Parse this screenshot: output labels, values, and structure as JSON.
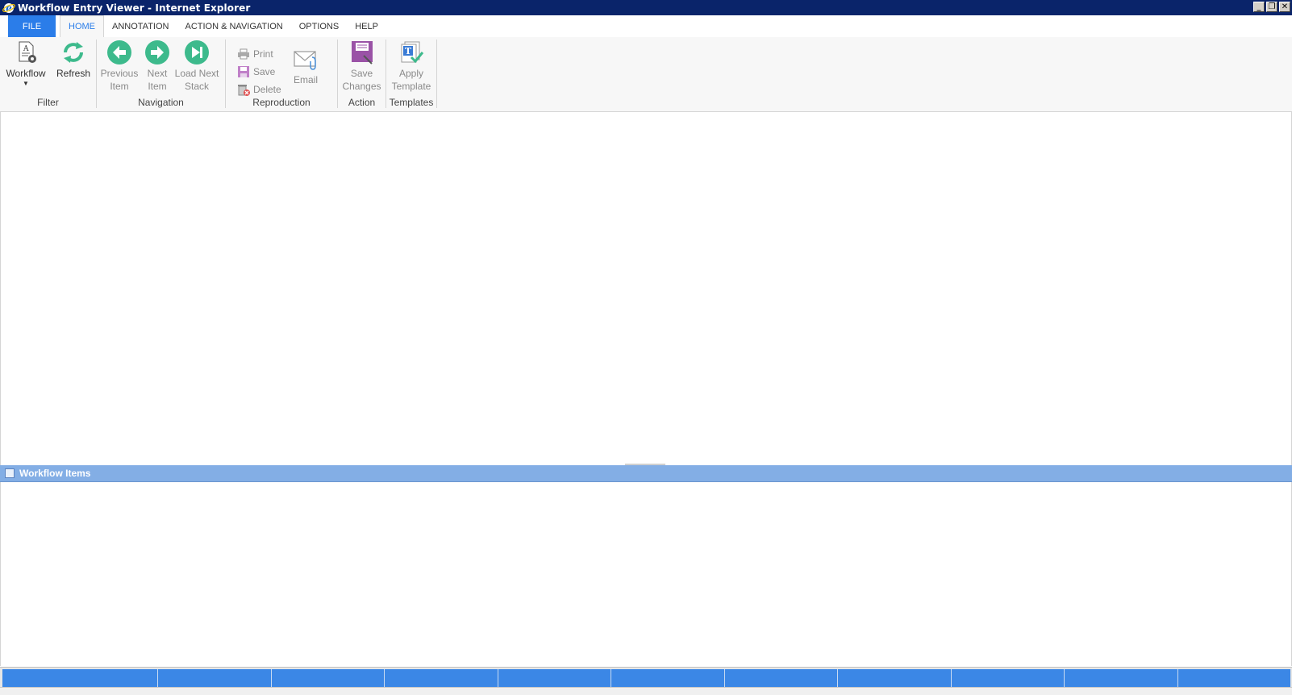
{
  "window": {
    "title": "Workflow Entry Viewer - Internet Explorer",
    "controls": [
      "minimize",
      "restore",
      "close"
    ]
  },
  "tabs": [
    {
      "label": "FILE"
    },
    {
      "label": "HOME"
    },
    {
      "label": "ANNOTATION"
    },
    {
      "label": "ACTION & NAVIGATION"
    },
    {
      "label": "OPTIONS"
    },
    {
      "label": "HELP"
    }
  ],
  "ribbon": {
    "filter": {
      "label": "Filter",
      "workflow": "Workflow",
      "refresh": "Refresh"
    },
    "navigation": {
      "label": "Navigation",
      "previous_line1": "Previous",
      "previous_line2": "Item",
      "next_line1": "Next",
      "next_line2": "Item",
      "load_line1": "Load Next",
      "load_line2": "Stack"
    },
    "reproduction": {
      "label": "Reproduction",
      "print": "Print",
      "save": "Save",
      "delete": "Delete",
      "email": "Email"
    },
    "action": {
      "label": "Action",
      "save_line1": "Save",
      "save_line2": "Changes"
    },
    "templates": {
      "label": "Templates",
      "apply_line1": "Apply",
      "apply_line2": "Template"
    }
  },
  "workflow_items": {
    "title": "Workflow Items"
  },
  "colors": {
    "accent": "#2b7de9",
    "nav_green": "#3dba8c",
    "panel_header": "#83aee5",
    "status_blue": "#3b87e6"
  }
}
